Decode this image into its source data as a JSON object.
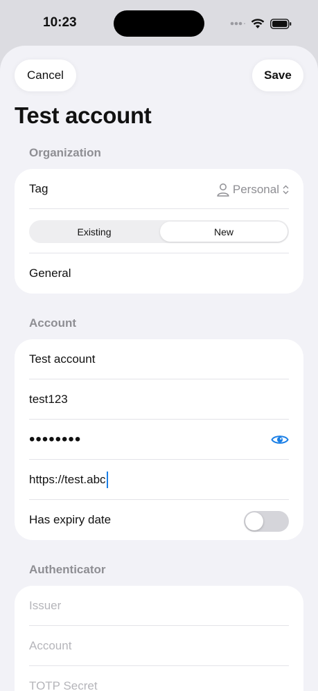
{
  "status_bar": {
    "time": "10:23",
    "icons": [
      "signal-icon",
      "wifi-icon",
      "battery-icon"
    ]
  },
  "nav": {
    "cancel_label": "Cancel",
    "save_label": "Save"
  },
  "title": "Test account",
  "organization": {
    "header": "Organization",
    "tag_label": "Tag",
    "tag_value": "Personal",
    "segments": [
      "Existing",
      "New"
    ],
    "selected_segment": "New",
    "folder_value": "General"
  },
  "account": {
    "header": "Account",
    "name_value": "Test account",
    "username_value": "test123",
    "password_value": "••••••••",
    "url_value": "https://test.abc",
    "expiry_label": "Has expiry date",
    "expiry_enabled": false
  },
  "authenticator": {
    "header": "Authenticator",
    "issuer_placeholder": "Issuer",
    "account_placeholder": "Account",
    "secret_placeholder": "TOTP Secret"
  },
  "colors": {
    "accent": "#1a7fe6",
    "background": "#f2f2f7",
    "secondary_text": "#8e8e93"
  }
}
